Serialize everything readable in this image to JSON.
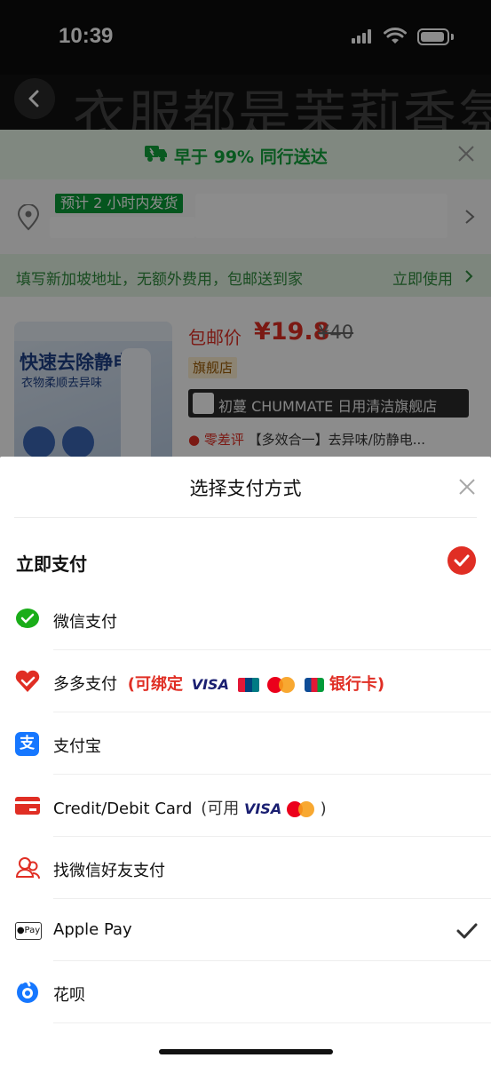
{
  "status_bar": {
    "time": "10:39"
  },
  "background": {
    "title_text": "衣服都是茉莉香氛",
    "shipping_banner": "早于 99% 同行送达",
    "address_tag": "预计 2 小时内发货",
    "sg_promo": "填写新加坡地址，无额外费用，包邮送到家",
    "sg_promo_link": "立即使用",
    "product": {
      "thumb_title": "快速去除静电",
      "thumb_subtitle": "衣物柔顺去异味",
      "price_label": "包邮价",
      "price": "¥19.8",
      "price_old": "¥40",
      "flagship_tag": "旗舰店",
      "store_name": "初蔓 CHUMMATE 日用清洁旗舰店",
      "desc_red": "零差评",
      "desc": "【多效合一】去异味/防静电..."
    }
  },
  "sheet": {
    "title": "选择支付方式",
    "section_title": "立即支付",
    "methods": [
      {
        "label": "微信支付",
        "icon": "wechat-pay-icon"
      },
      {
        "label": "多多支付",
        "extra_prefix": "(可绑定",
        "extra_suffix": "银行卡)",
        "visa": "VISA",
        "icon": "duoduo-pay-icon"
      },
      {
        "label": "支付宝",
        "icon": "alipay-icon"
      },
      {
        "label": "Credit/Debit Card",
        "extra_prefix": "(可用",
        "extra_suffix": ")",
        "visa": "VISA",
        "icon": "credit-card-icon"
      },
      {
        "label": "找微信好友支付",
        "icon": "wechat-friend-icon"
      },
      {
        "label": "Apple Pay",
        "icon_text": "Pay",
        "icon": "apple-pay-icon",
        "selected": true
      },
      {
        "label": "花呗",
        "icon": "huabei-icon"
      }
    ]
  },
  "colors": {
    "accent": "#e02e24",
    "wechat": "#1aad19",
    "alipay": "#1677ff"
  }
}
